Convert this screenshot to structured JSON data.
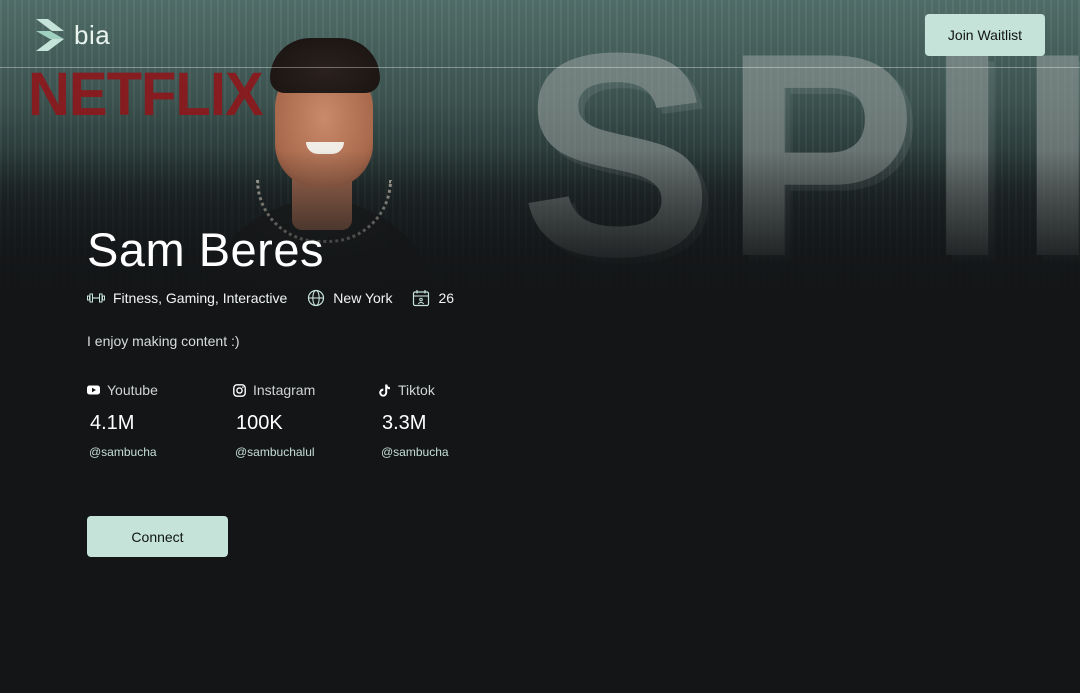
{
  "brand": {
    "name": "bia",
    "accent": "#c5e3d9"
  },
  "header": {
    "waitlist_label": "Join Waitlist"
  },
  "backdrop": {
    "logo_text": "NETFLIX",
    "word_text": "SPII"
  },
  "profile": {
    "name": "Sam Beres",
    "categories": "Fitness, Gaming, Interactive",
    "location": "New York",
    "age": "26",
    "bio": "I enjoy making content :)"
  },
  "socials": [
    {
      "platform": "Youtube",
      "icon": "youtube-icon",
      "count": "4.1M",
      "handle": "@sambucha"
    },
    {
      "platform": "Instagram",
      "icon": "instagram-icon",
      "count": "100K",
      "handle": "@sambuchalul"
    },
    {
      "platform": "Tiktok",
      "icon": "tiktok-icon",
      "count": "3.3M",
      "handle": "@sambucha"
    }
  ],
  "actions": {
    "connect_label": "Connect"
  }
}
